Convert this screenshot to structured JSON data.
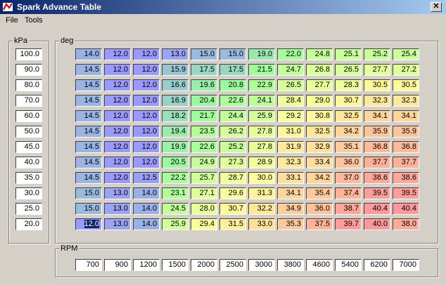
{
  "window": {
    "title": "Spark Advance Table",
    "close_label": "✕"
  },
  "menu": {
    "file": "File",
    "tools": "Tools"
  },
  "kpa": {
    "label": "kPa",
    "values": [
      "100.0",
      "90.0",
      "80.0",
      "70.0",
      "60.0",
      "50.0",
      "45.0",
      "40.0",
      "35.0",
      "30.0",
      "25.0",
      "20.0"
    ]
  },
  "deg": {
    "label": "deg",
    "rows": [
      [
        "14.0",
        "12.0",
        "12.0",
        "13.0",
        "15.0",
        "15.0",
        "19.0",
        "22.0",
        "24.8",
        "25.1",
        "25.2",
        "25.4"
      ],
      [
        "14.5",
        "12.0",
        "12.0",
        "15.9",
        "17.5",
        "17.5",
        "21.5",
        "24.7",
        "26.8",
        "26.5",
        "27.7",
        "27.2"
      ],
      [
        "14.5",
        "12.0",
        "12.0",
        "16.6",
        "19.6",
        "20.8",
        "22.9",
        "26.5",
        "27.7",
        "28.3",
        "30.5",
        "30.5"
      ],
      [
        "14.5",
        "12.0",
        "12.0",
        "16.9",
        "20.4",
        "22.6",
        "24.1",
        "28.4",
        "29.0",
        "30.7",
        "32.3",
        "32.3"
      ],
      [
        "14.5",
        "12.0",
        "12.0",
        "18.2",
        "21.7",
        "24.4",
        "25.9",
        "29.2",
        "30.8",
        "32.5",
        "34.1",
        "34.1"
      ],
      [
        "14.5",
        "12.0",
        "12.0",
        "19.4",
        "23.5",
        "26.2",
        "27.8",
        "31.0",
        "32.5",
        "34.2",
        "35.9",
        "35.9"
      ],
      [
        "14.5",
        "12.0",
        "12.0",
        "19.9",
        "22.6",
        "25.2",
        "27.8",
        "31.9",
        "32.9",
        "35.1",
        "36.8",
        "36.8"
      ],
      [
        "14.5",
        "12.0",
        "12.0",
        "20.5",
        "24.9",
        "27.3",
        "28.9",
        "32.3",
        "33.4",
        "36.0",
        "37.7",
        "37.7"
      ],
      [
        "14.5",
        "12.0",
        "12.5",
        "22.2",
        "25.7",
        "28.7",
        "30.0",
        "33.1",
        "34.2",
        "37.0",
        "38.6",
        "38.6"
      ],
      [
        "15.0",
        "13.0",
        "14.0",
        "23.1",
        "27.1",
        "29.6",
        "31.3",
        "34.1",
        "35.4",
        "37.4",
        "39.5",
        "39.5"
      ],
      [
        "15.0",
        "13.0",
        "14.0",
        "24.5",
        "28.0",
        "30.7",
        "32.2",
        "34.9",
        "36.0",
        "38.7",
        "40.4",
        "40.4"
      ],
      [
        "12.0",
        "13.0",
        "14.0",
        "25.9",
        "29.4",
        "31.5",
        "33.0",
        "35.3",
        "37.5",
        "39.7",
        "40.0",
        "38.0"
      ]
    ]
  },
  "rpm": {
    "label": "RPM",
    "values": [
      "700",
      "900",
      "1200",
      "1500",
      "2000",
      "2500",
      "3000",
      "3800",
      "4600",
      "5400",
      "6200",
      "7000"
    ]
  },
  "colors": {
    "low": "#9999ff",
    "mid_low": "#99ff99",
    "mid_high": "#ffff99",
    "high": "#ff9999"
  }
}
